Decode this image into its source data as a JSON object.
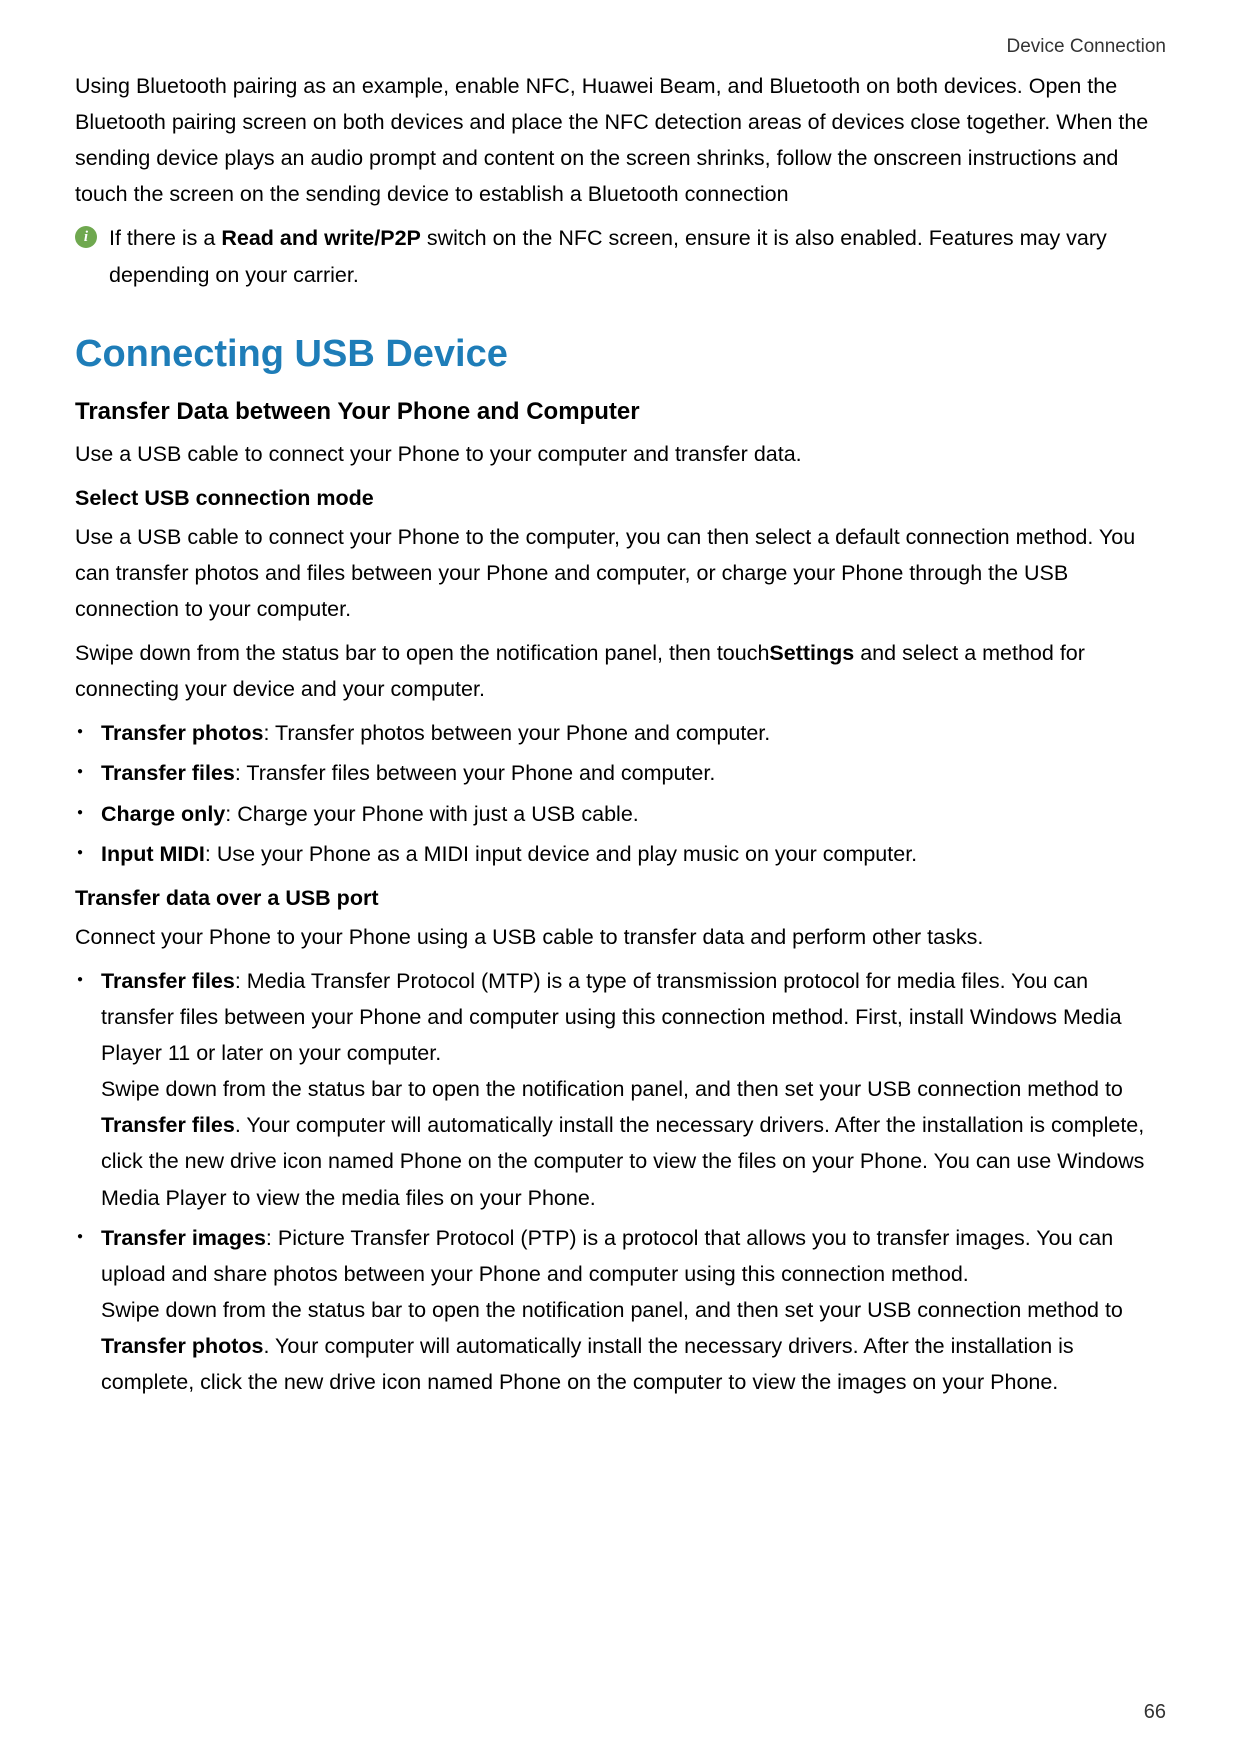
{
  "header": {
    "title": "Device Connection"
  },
  "intro_para": "Using Bluetooth pairing as an example, enable NFC, Huawei Beam, and Bluetooth on both devices. Open the Bluetooth pairing screen on both devices and place the NFC detection areas of devices close together. When the sending device plays an audio prompt and content on the screen shrinks, follow the onscreen instructions and touch the screen on the sending device to establish a Bluetooth connection",
  "note": {
    "icon": "i",
    "before_bold": "If there is a ",
    "bold": "Read and write/P2P",
    "after_bold": " switch on the NFC screen, ensure it is also enabled. Features may vary depending on your carrier."
  },
  "section_title": "Connecting USB Device",
  "sub_title": "Transfer Data between Your Phone and Computer",
  "sub_intro": "Use a USB cable to connect your Phone to your computer and transfer data.",
  "select_mode_heading": "Select USB connection mode",
  "select_mode_para": "Use a USB cable to connect your Phone to the computer, you can then select a default connection method. You can transfer photos and files between your Phone and computer, or charge your Phone through the USB connection to your computer.",
  "swipe_para": {
    "before": "Swipe down from the status bar to open the notification panel, then touch",
    "bold": "Settings",
    "after": " and select a method for connecting your device and your computer."
  },
  "mode_list": [
    {
      "bold": "Transfer photos",
      "rest": ": Transfer photos between your Phone and computer."
    },
    {
      "bold": "Transfer files",
      "rest": ": Transfer files between your Phone and computer."
    },
    {
      "bold": "Charge only",
      "rest": ": Charge your Phone with just a USB cable."
    },
    {
      "bold": "Input MIDI",
      "rest": ": Use your Phone as a MIDI input device and play music on your computer."
    }
  ],
  "transfer_port_heading": "Transfer data over a USB port",
  "transfer_port_intro": "Connect your Phone to your Phone using a USB cable to transfer data and perform other tasks.",
  "port_list": [
    {
      "bold": "Transfer files",
      "rest_line": ": Media Transfer Protocol (MTP) is a type of transmission protocol for media files. You can transfer files between your Phone and computer using this connection method. First, install Windows Media Player 11 or later on your computer.",
      "para2_before": "Swipe down from the status bar to open the notification panel, and then set your USB connection method to ",
      "para2_bold": "Transfer files",
      "para2_after": ". Your computer will automatically install the necessary drivers. After the installation is complete, click the new drive icon named Phone on the computer to view the files on your Phone. You can use Windows Media Player to view the media files on your Phone."
    },
    {
      "bold": "Transfer images",
      "rest_line": ": Picture Transfer Protocol (PTP) is a protocol that allows you to transfer images. You can upload and share photos between your Phone and computer using this connection method.",
      "para2_before": "Swipe down from the status bar to open the notification panel, and then set your USB connection method to ",
      "para2_bold": "Transfer photos",
      "para2_after": ". Your computer will automatically install the necessary drivers. After the installation is complete, click the new drive icon named Phone on the computer to view the images on your Phone."
    }
  ],
  "page_number": "66"
}
